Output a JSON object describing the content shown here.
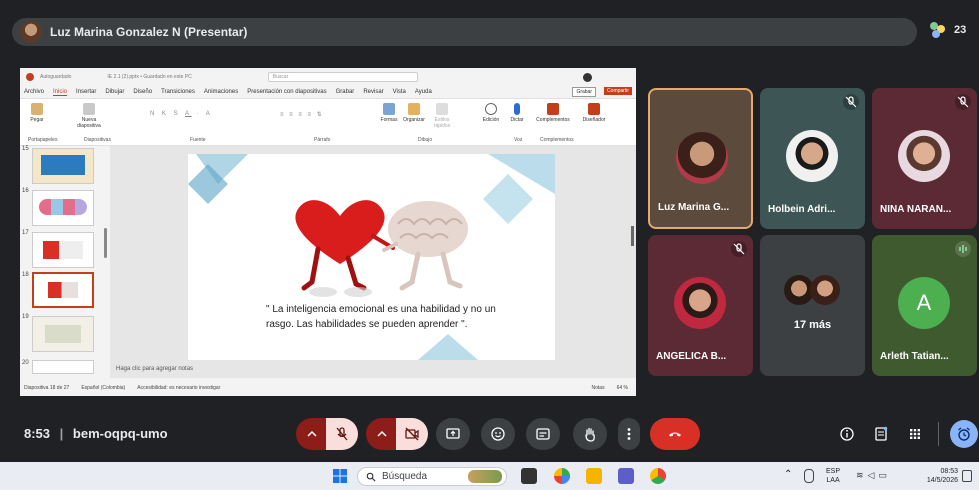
{
  "meet": {
    "presenter_label": "Luz Marina Gonzalez N (Presentar)",
    "participant_count": "23",
    "time": "8:53",
    "separator": "|",
    "meeting_code": "bem-oqpq-umo",
    "tiles": [
      {
        "name": "Luz Marina G...",
        "bg": "#5c4a3d",
        "border": "#e8a86b",
        "muted": false
      },
      {
        "name": "Holbein Adri...",
        "bg": "#3d5554",
        "muted": true
      },
      {
        "name": "NINA NARAN...",
        "bg": "#5b2a35",
        "muted": true
      },
      {
        "name": "ANGELICA B...",
        "bg": "#5b2a35",
        "muted": true
      },
      {
        "name": "17 más",
        "bg": "#3c4043",
        "muted": false
      },
      {
        "name": "Arleth Tatian...",
        "bg": "#3f5a2e",
        "initial": "A",
        "muted": true
      }
    ]
  },
  "ppt": {
    "title_left": "Autoguardado",
    "title_file": "IE 2.1 (2).pptx • Guardado en este PC",
    "search_placeholder": "Buscar",
    "menu": [
      "Archivo",
      "Inicio",
      "Insertar",
      "Dibujar",
      "Diseño",
      "Transiciones",
      "Animaciones",
      "Presentación con diapositivas",
      "Grabar",
      "Revisar",
      "Vista",
      "Ayuda"
    ],
    "grabar_button": "Grabar",
    "share_button": "Compartir",
    "ribbon_groups": [
      "Portapapeles",
      "Diapositivas",
      "Fuente",
      "Párrafo",
      "Dibujo",
      "Voz",
      "Complementos"
    ],
    "ribbon_buttons": [
      "Pegar",
      "Nueva diapositiva",
      "Formas",
      "Organizar",
      "Estilos rápidos",
      "Edición",
      "Dictar",
      "Complementos",
      "Diseñador"
    ],
    "thumb_numbers": [
      "15",
      "16",
      "17",
      "18",
      "19",
      "20"
    ],
    "slide_quote": "\" La inteligencia emocional es una habilidad y no un rasgo. Las habilidades se pueden aprender \".",
    "notes_placeholder": "Haga clic para agregar notas",
    "status": {
      "slide": "Diapositiva 18 de 27",
      "language": "Español (Colombia)",
      "accessibility": "Accesibilidad: es necesario investigar",
      "notes": "Notas",
      "zoom": "64 %"
    }
  },
  "taskbar": {
    "search_label": "Búsqueda",
    "lang_line1": "ESP",
    "lang_line2": "LAA",
    "clock_time": "08:53",
    "clock_date": "14/5/2026"
  },
  "colors": {
    "meet_bg": "#202124",
    "end_call": "#d93025",
    "accent_blue": "#8ab4f8",
    "ppt_accent": "#c43e1c"
  }
}
